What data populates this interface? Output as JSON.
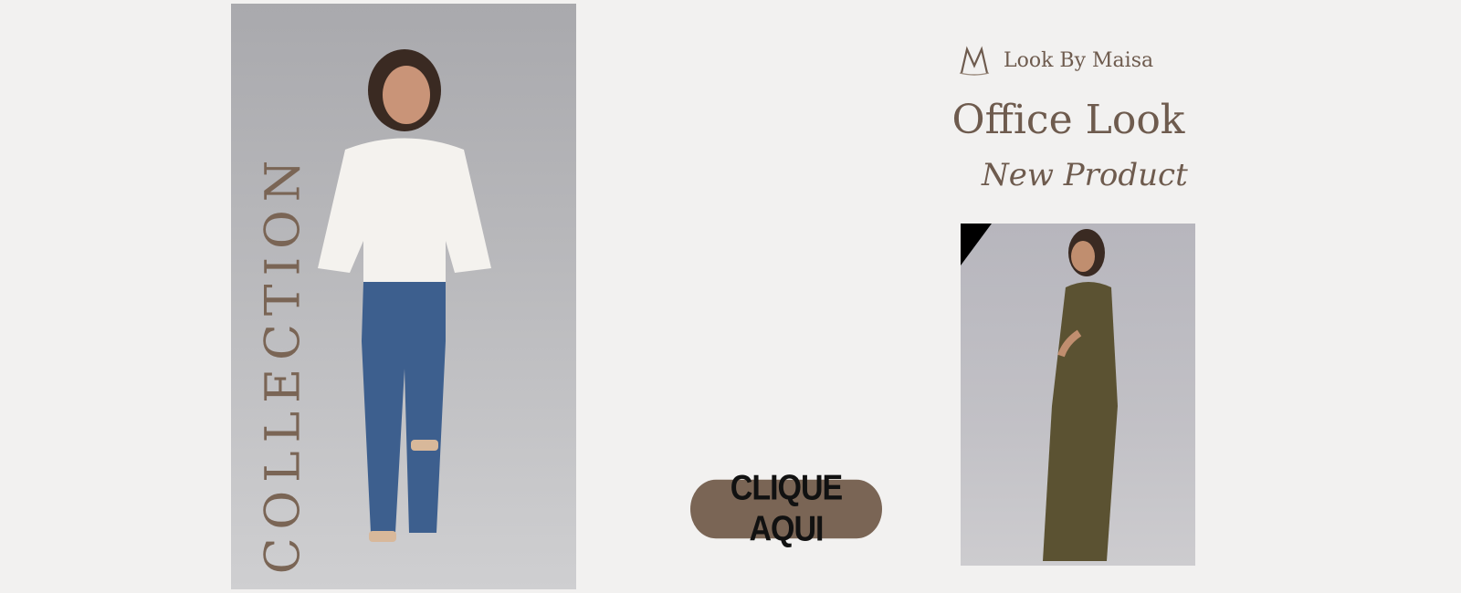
{
  "brand": {
    "logo_icon": "monogram-logo-icon",
    "name": "Look By Maisa"
  },
  "hero": {
    "vertical_text": "COLLECTION",
    "headline": "Office Look",
    "subheadline": "New Product"
  },
  "cta": {
    "label": "CLIQUE AQUI"
  },
  "colors": {
    "background": "#f2f1f0",
    "accent_brown": "#7a6555",
    "text_brown": "#6e5b4e"
  }
}
